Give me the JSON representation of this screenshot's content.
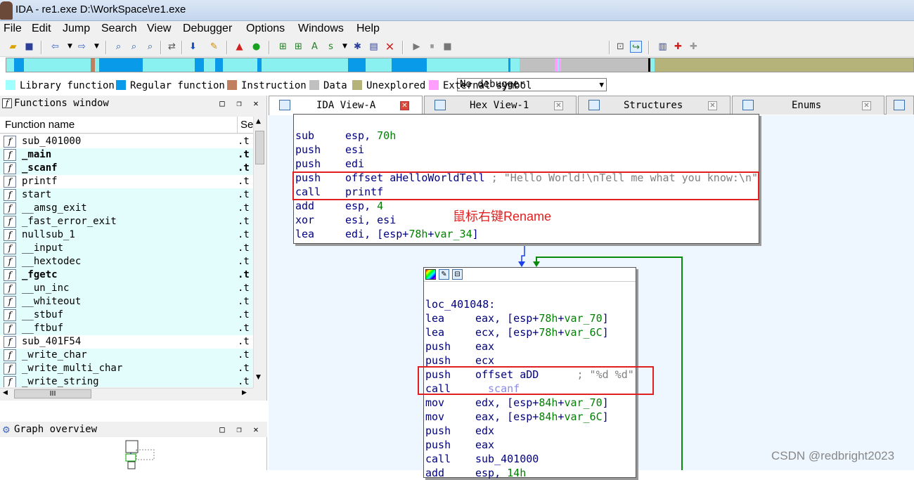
{
  "window": {
    "title": "IDA - re1.exe D:\\WorkSpace\\re1.exe"
  },
  "menu": [
    "File",
    "Edit",
    "Jump",
    "Search",
    "View",
    "Debugger",
    "Options",
    "Windows",
    "Help"
  ],
  "toolbar": {
    "debugger_select": "No debugger"
  },
  "legend": [
    {
      "label": "Library function",
      "color": "#a0ffff"
    },
    {
      "label": "Regular function",
      "color": "#0a9aea"
    },
    {
      "label": "Instruction",
      "color": "#c08060"
    },
    {
      "label": "Data",
      "color": "#c0c0c0"
    },
    {
      "label": "Unexplored",
      "color": "#b5b27a"
    },
    {
      "label": "External symbol",
      "color": "#ff9eff"
    }
  ],
  "functions_window": {
    "title": "Functions window",
    "col_name": "Function name",
    "col_seg": "Se",
    "rows": [
      {
        "name": "sub_401000",
        "seg": ".t",
        "bold": false,
        "lib": false
      },
      {
        "name": "_main",
        "seg": ".t",
        "bold": true,
        "lib": true
      },
      {
        "name": "_scanf",
        "seg": ".t",
        "bold": true,
        "lib": true
      },
      {
        "name": "printf",
        "seg": ".t",
        "bold": false,
        "lib": false
      },
      {
        "name": "start",
        "seg": ".t",
        "bold": false,
        "lib": true
      },
      {
        "name": "__amsg_exit",
        "seg": ".t",
        "bold": false,
        "lib": true
      },
      {
        "name": "_fast_error_exit",
        "seg": ".t",
        "bold": false,
        "lib": true
      },
      {
        "name": "nullsub_1",
        "seg": ".t",
        "bold": false,
        "lib": true
      },
      {
        "name": "__input",
        "seg": ".t",
        "bold": false,
        "lib": true
      },
      {
        "name": "__hextodec",
        "seg": ".t",
        "bold": false,
        "lib": true
      },
      {
        "name": "_fgetc",
        "seg": ".t",
        "bold": true,
        "lib": true
      },
      {
        "name": "__un_inc",
        "seg": ".t",
        "bold": false,
        "lib": true
      },
      {
        "name": "__whiteout",
        "seg": ".t",
        "bold": false,
        "lib": true
      },
      {
        "name": "__stbuf",
        "seg": ".t",
        "bold": false,
        "lib": true
      },
      {
        "name": "__ftbuf",
        "seg": ".t",
        "bold": false,
        "lib": true
      },
      {
        "name": "sub_401F54",
        "seg": ".t",
        "bold": false,
        "lib": false
      },
      {
        "name": "_write_char",
        "seg": ".t",
        "bold": false,
        "lib": true
      },
      {
        "name": "_write_multi_char",
        "seg": ".t",
        "bold": false,
        "lib": true
      },
      {
        "name": "_write_string",
        "seg": ".t",
        "bold": false,
        "lib": true
      }
    ],
    "hscroll_thumb": "III"
  },
  "graph_overview": {
    "title": "Graph overview"
  },
  "tabs": [
    {
      "label": "IDA View-A",
      "active": true
    },
    {
      "label": "Hex View-1",
      "active": false
    },
    {
      "label": "Structures",
      "active": false
    },
    {
      "label": "Enums",
      "active": false
    }
  ],
  "block1": [
    {
      "mn": "sub",
      "ops": [
        [
          "esp, ",
          "op"
        ],
        [
          "70h",
          "num"
        ]
      ]
    },
    {
      "mn": "push",
      "ops": [
        [
          "esi",
          "op"
        ]
      ]
    },
    {
      "mn": "push",
      "ops": [
        [
          "edi",
          "op"
        ]
      ]
    },
    {
      "mn": "push",
      "ops": [
        [
          "offset aHelloWorldTell",
          "op"
        ],
        [
          " ; \"Hello World!\\nTell me what you know:\\n\"",
          "cm"
        ]
      ]
    },
    {
      "mn": "call",
      "ops": [
        [
          "printf",
          "op"
        ]
      ]
    },
    {
      "mn": "add",
      "ops": [
        [
          "esp, ",
          "op"
        ],
        [
          "4",
          "num"
        ]
      ]
    },
    {
      "mn": "xor",
      "ops": [
        [
          "esi, esi",
          "op"
        ]
      ]
    },
    {
      "mn": "lea",
      "ops": [
        [
          "edi, [esp+",
          "op"
        ],
        [
          "78h",
          "num"
        ],
        [
          "+",
          "op"
        ],
        [
          "var_34",
          "var"
        ],
        [
          "]",
          "op"
        ]
      ]
    }
  ],
  "block2": {
    "label": "loc_401048:",
    "lines": [
      {
        "mn": "lea",
        "ops": [
          [
            "eax, [esp+",
            "op"
          ],
          [
            "78h",
            "num"
          ],
          [
            "+",
            "op"
          ],
          [
            "var_70",
            "var"
          ],
          [
            "]",
            "op"
          ]
        ]
      },
      {
        "mn": "lea",
        "ops": [
          [
            "ecx, [esp+",
            "op"
          ],
          [
            "78h",
            "num"
          ],
          [
            "+",
            "op"
          ],
          [
            "var_6C",
            "var"
          ],
          [
            "]",
            "op"
          ]
        ]
      },
      {
        "mn": "push",
        "ops": [
          [
            "eax",
            "op"
          ]
        ]
      },
      {
        "mn": "push",
        "ops": [
          [
            "ecx",
            "op"
          ]
        ]
      },
      {
        "mn": "push",
        "ops": [
          [
            "offset aDD",
            "op"
          ],
          [
            "      ; \"%d %d\"",
            "cm"
          ]
        ]
      },
      {
        "mn": "call",
        "ops": [
          [
            "_scanf",
            "cm"
          ]
        ]
      },
      {
        "mn": "mov",
        "ops": [
          [
            "edx, [esp+",
            "op"
          ],
          [
            "84h",
            "num"
          ],
          [
            "+",
            "op"
          ],
          [
            "var_70",
            "var"
          ],
          [
            "]",
            "op"
          ]
        ]
      },
      {
        "mn": "mov",
        "ops": [
          [
            "eax, [esp+",
            "op"
          ],
          [
            "84h",
            "num"
          ],
          [
            "+",
            "op"
          ],
          [
            "var_6C",
            "var"
          ],
          [
            "]",
            "op"
          ]
        ]
      },
      {
        "mn": "push",
        "ops": [
          [
            "edx",
            "op"
          ]
        ]
      },
      {
        "mn": "push",
        "ops": [
          [
            "eax",
            "op"
          ]
        ]
      },
      {
        "mn": "call",
        "ops": [
          [
            "sub_401000",
            "op"
          ]
        ]
      },
      {
        "mn": "add",
        "ops": [
          [
            "esp, ",
            "op"
          ],
          [
            "14h",
            "num"
          ]
        ]
      }
    ]
  },
  "annotation": "鼠标右键Rename",
  "watermark": "CSDN @redbright2023"
}
